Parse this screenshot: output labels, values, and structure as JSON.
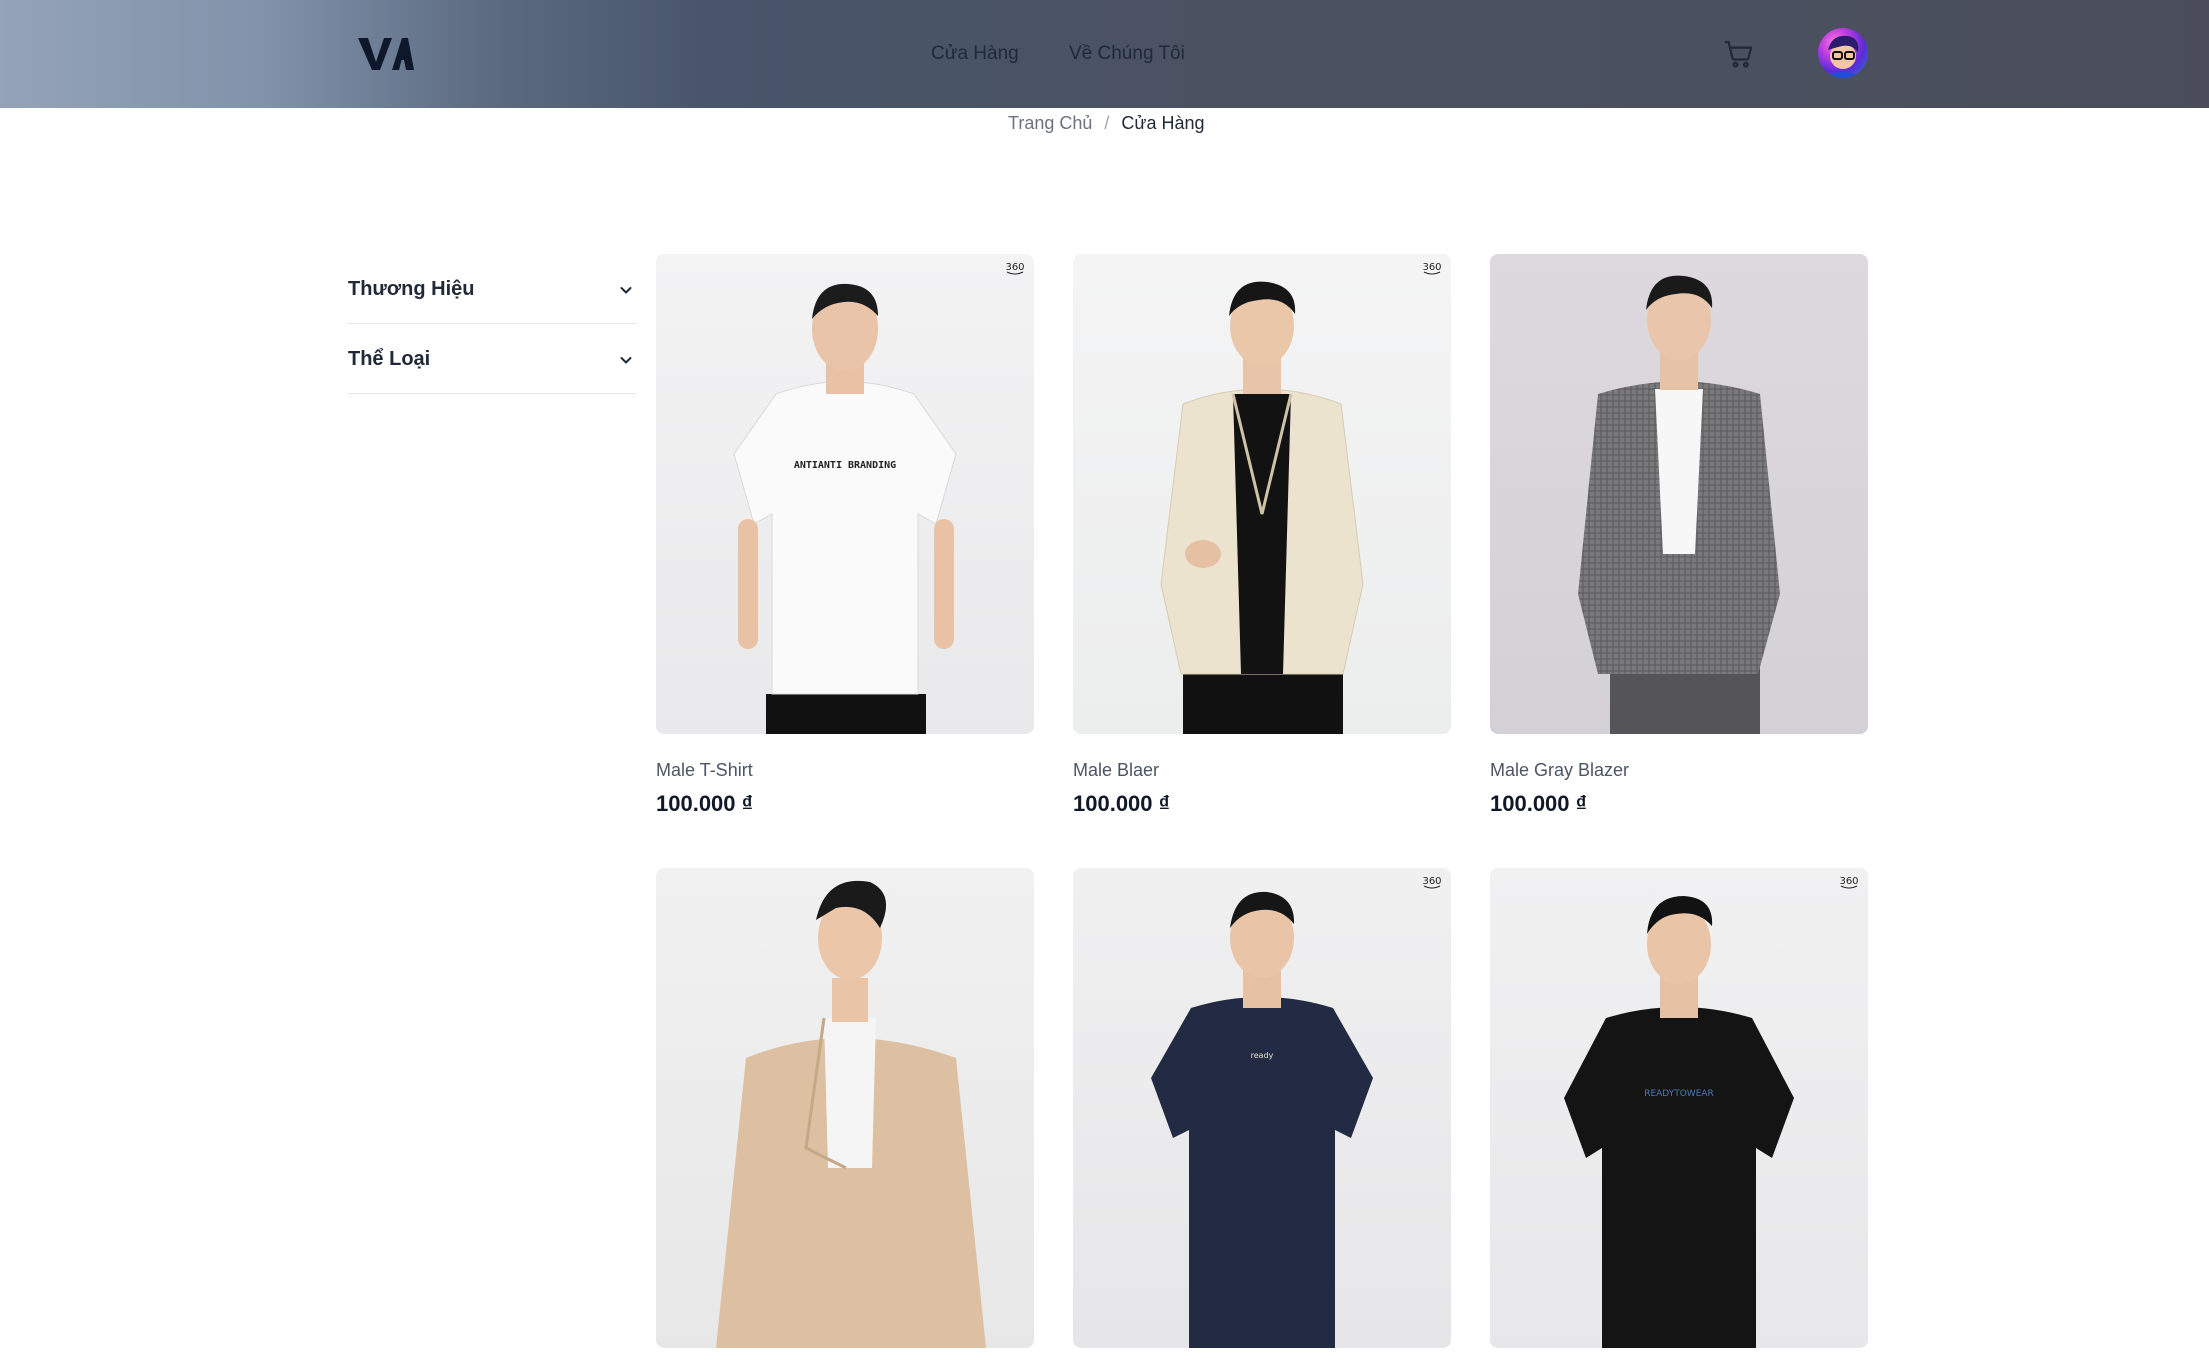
{
  "header": {
    "logo_text": "VA",
    "nav": [
      {
        "label": "Cửa Hàng"
      },
      {
        "label": "Về Chúng Tôi"
      }
    ],
    "cart_icon": "shopping-cart-icon",
    "avatar_icon": "user-avatar"
  },
  "breadcrumb": {
    "home": "Trang Chủ",
    "separator": "/",
    "current": "Cửa Hàng"
  },
  "filters": [
    {
      "label": "Thương Hiệu",
      "icon": "chevron-down-icon"
    },
    {
      "label": "Thể Loại",
      "icon": "chevron-down-icon"
    }
  ],
  "products": [
    {
      "name": "Male T-Shirt",
      "price": "100.000 ₫",
      "has_360": true
    },
    {
      "name": "Male Blaer",
      "price": "100.000 ₫",
      "has_360": true
    },
    {
      "name": "Male Gray Blazer",
      "price": "100.000 ₫",
      "has_360": false
    },
    {
      "name": "",
      "price": "",
      "has_360": false
    },
    {
      "name": "",
      "price": "",
      "has_360": true
    },
    {
      "name": "",
      "price": "",
      "has_360": true
    }
  ],
  "shirt_prints": {
    "white_tee": "ANTIANTI BRANDING",
    "black_tee": "READYTOWEAR"
  },
  "colors": {
    "header_start": "#94a3b8",
    "header_end": "#4a4d59",
    "text_primary": "#111827",
    "text_muted": "#6b7280"
  }
}
